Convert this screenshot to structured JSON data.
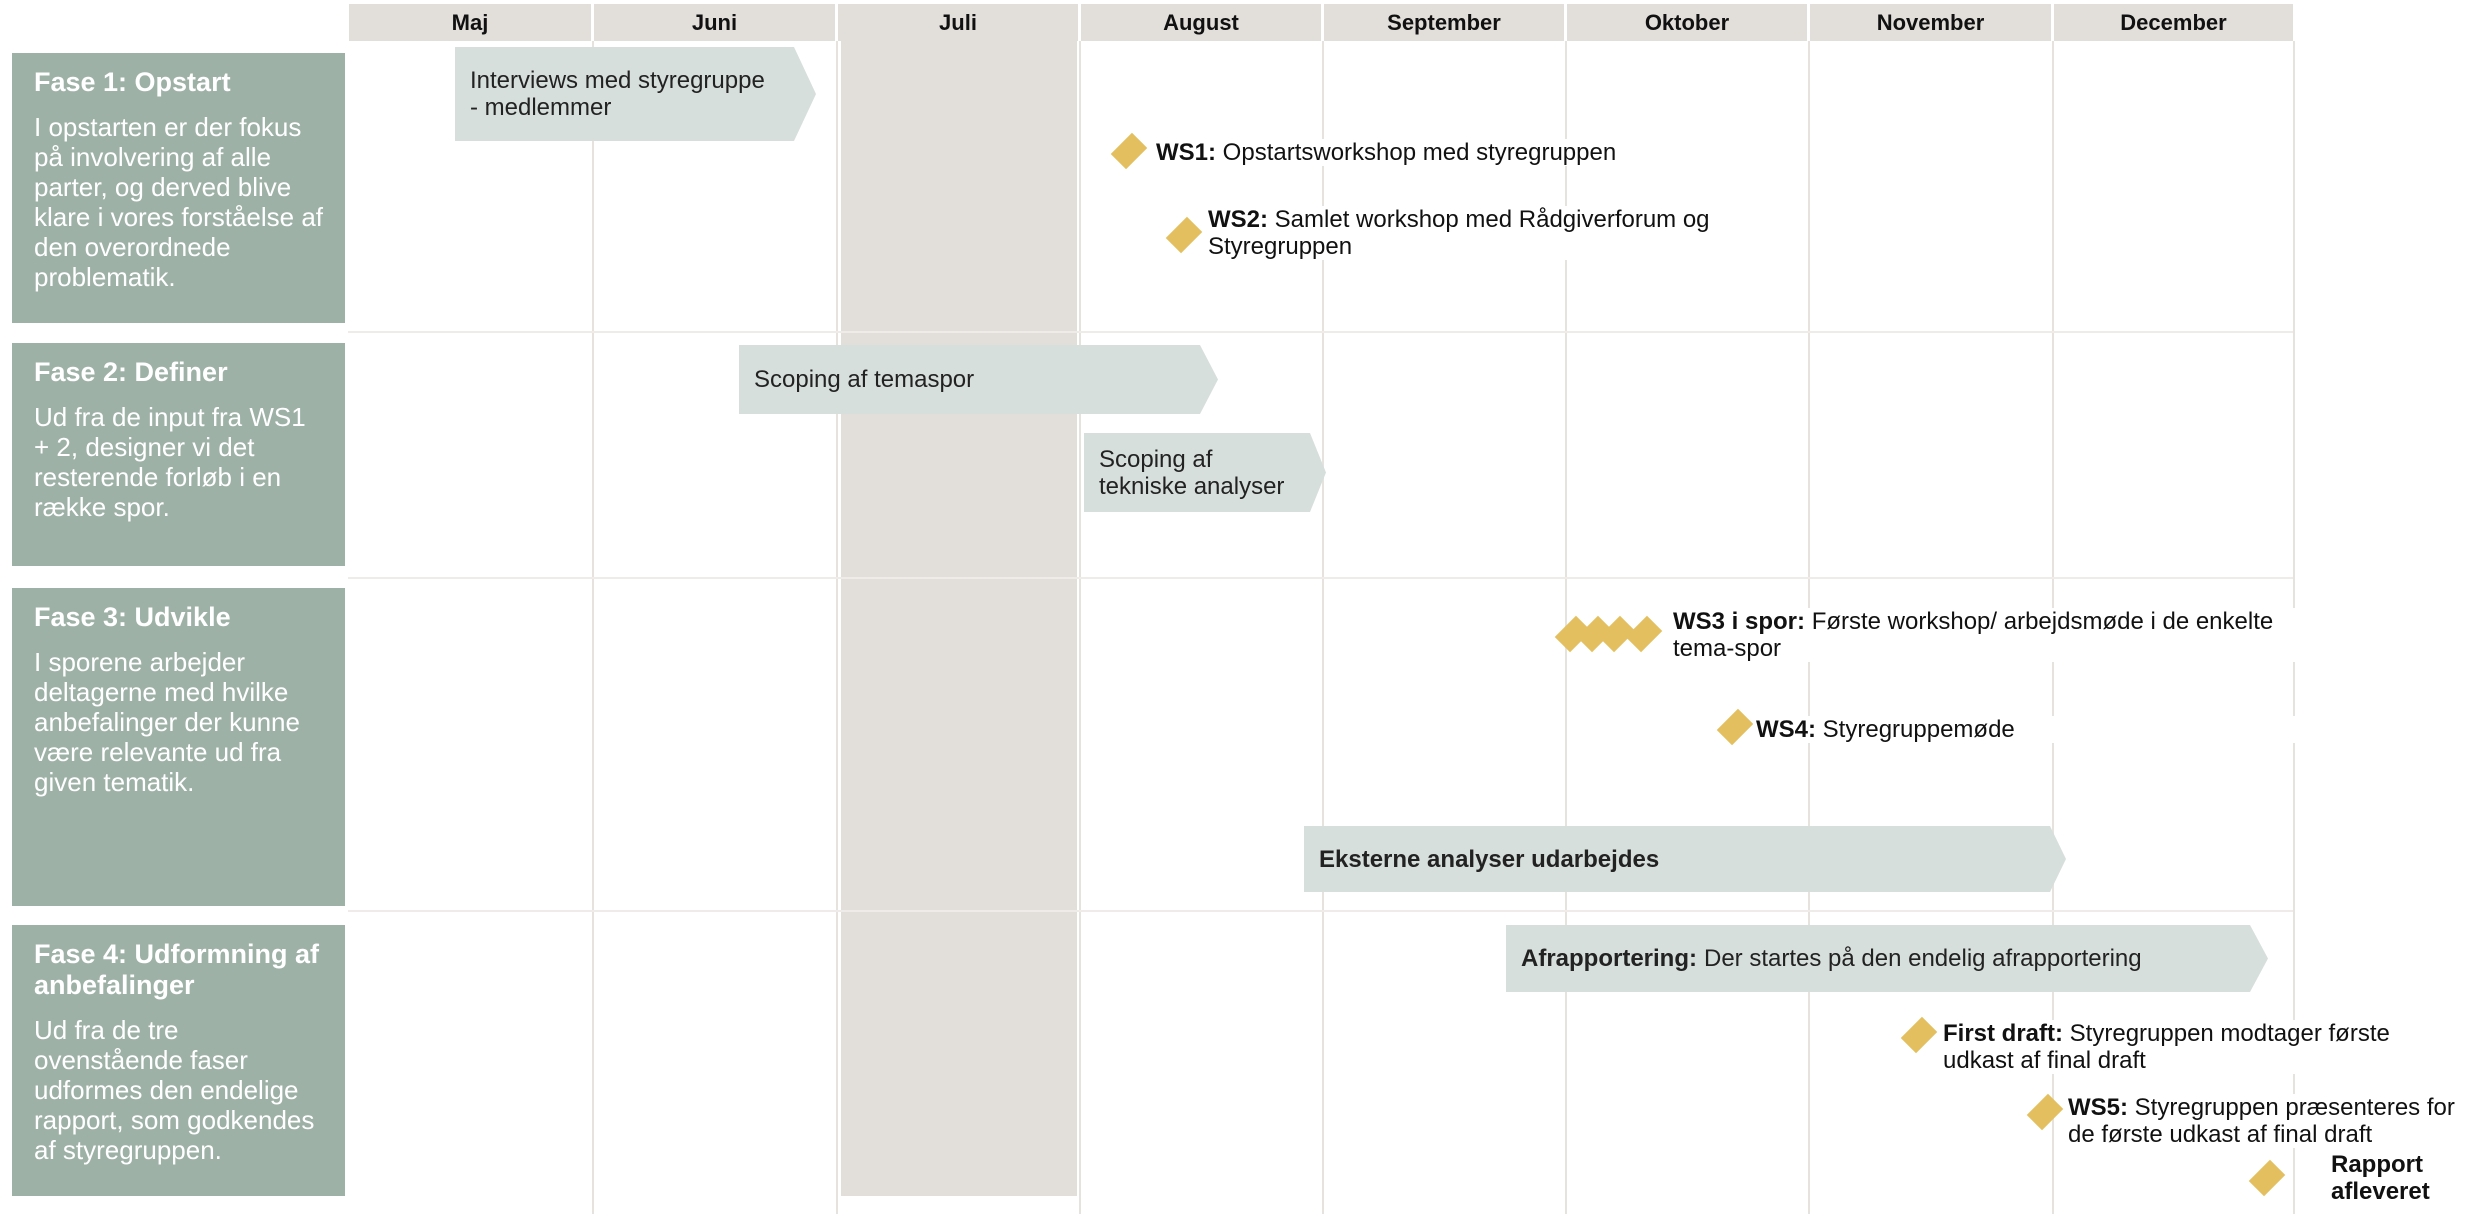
{
  "months": [
    "Maj",
    "Juni",
    "Juli",
    "August",
    "September",
    "Oktober",
    "November",
    "December"
  ],
  "phases": [
    {
      "title": "Fase 1: Opstart",
      "text": "I opstarten er der fokus på involvering af alle parter, og derved blive klare i vores forståelse af den overordnede problematik."
    },
    {
      "title": "Fase 2: Definer",
      "text": "Ud fra de input fra WS1 + 2, designer vi det resterende forløb i en række spor."
    },
    {
      "title": "Fase 3: Udvikle",
      "text": "I sporene arbejder deltagerne med hvilke anbefalinger der kunne være relevante ud fra given tematik."
    },
    {
      "title": "Fase 4: Udformning af anbefalinger",
      "text": "Ud fra de tre ovenstående faser udformes den endelige rapport, som godkendes af styregruppen."
    }
  ],
  "bars": [
    {
      "bold": "",
      "text": "Interviews med styregruppe - medlemmer"
    },
    {
      "bold": "",
      "text": "Scoping af temaspor"
    },
    {
      "bold": "",
      "text": "Scoping af tekniske analyser"
    },
    {
      "bold": "Eksterne analyser udarbejdes",
      "text": ""
    },
    {
      "bold": "Afrapportering:",
      "text": "Der startes på den endelig afrapportering"
    }
  ],
  "milestones": [
    {
      "bold": "WS1:",
      "text": "Opstartsworkshop med styregruppen"
    },
    {
      "bold": "WS2:",
      "text": "Samlet workshop med Rådgiverforum og Styregruppen"
    },
    {
      "bold": "WS3 i spor:",
      "text": "Første workshop/ arbejdsmøde i de enkelte tema-spor"
    },
    {
      "bold": "WS4:",
      "text": "Styregruppemøde"
    },
    {
      "bold": "First draft:",
      "text": "Styregruppen modtager første udkast af final draft"
    },
    {
      "bold": "WS5:",
      "text": "Styregruppen præsenteres for de første udkast af final draft"
    },
    {
      "bold": "Rapport afleveret",
      "text": ""
    }
  ],
  "colors": {
    "phase_box": "#9eb1a7",
    "bar": "#d6dfdb",
    "milestone": "#e3bf5f",
    "month_header": "#e2dfdb"
  }
}
